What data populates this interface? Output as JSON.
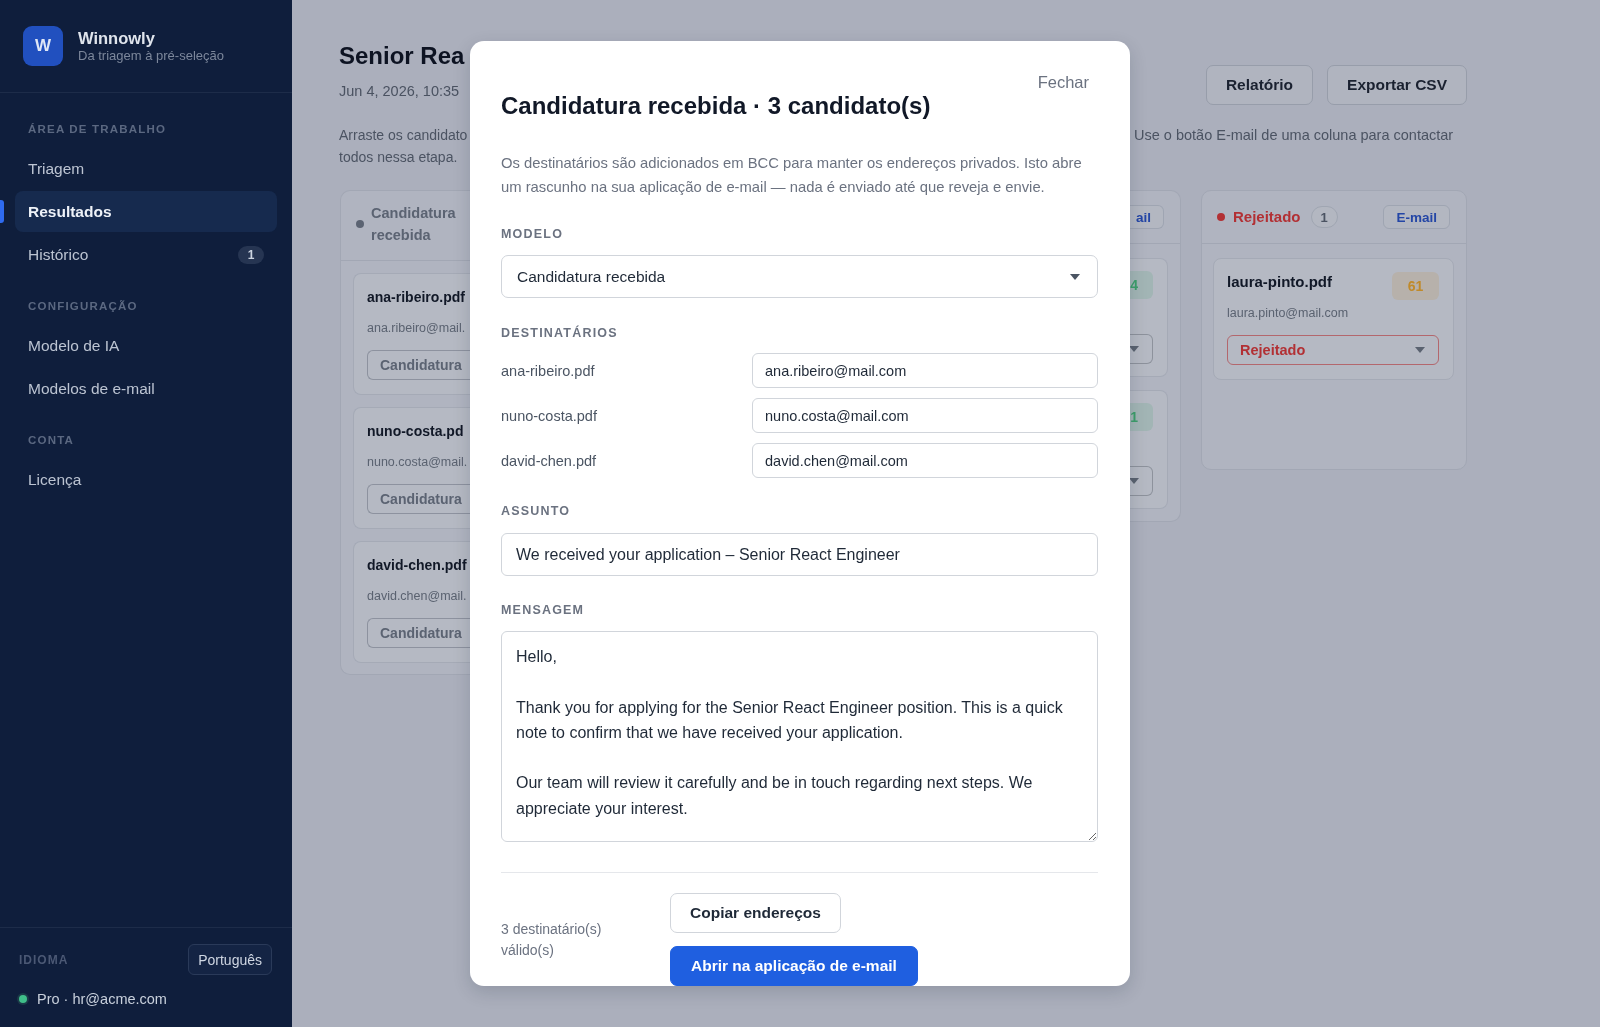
{
  "sidebar": {
    "logo": "W",
    "app_name": "Winnowly",
    "tagline": "Da triagem à pré-seleção",
    "sections": [
      {
        "heading": "ÁREA DE TRABALHO",
        "items": [
          {
            "label": "Triagem",
            "selected": false
          },
          {
            "label": "Resultados",
            "selected": true
          },
          {
            "label": "Histórico",
            "selected": false,
            "badge": "1"
          }
        ]
      },
      {
        "heading": "CONFIGURAÇÃO",
        "items": [
          {
            "label": "Modelo de IA",
            "selected": false
          },
          {
            "label": "Modelos de e-mail",
            "selected": false
          }
        ]
      },
      {
        "heading": "CONTA",
        "items": [
          {
            "label": "Licença",
            "selected": false
          }
        ]
      }
    ],
    "language": {
      "label": "IDIOMA",
      "button": "Português"
    },
    "account": {
      "color": "#3fbf8a",
      "text": "Pro · hr@acme.com"
    }
  },
  "page": {
    "title": "Senior Rea",
    "date": "Jun 4, 2026, 10:35",
    "description": {
      "line_1_left": "Arraste os candidato",
      "line_1_right": "Use o botão E-mail de uma coluna para contactar",
      "line_2": "todos nessa etapa."
    },
    "actions": [
      "Relatório",
      "Exportar CSV"
    ]
  },
  "board": {
    "columns": [
      {
        "kind": "left_part",
        "title": "Candidatura recebida",
        "color": "#5b6372",
        "cards": [
          {
            "file": "ana-ribeiro.pdf",
            "email": "ana.ribeiro@mail.",
            "status": "Candidatura"
          },
          {
            "file": "nuno-costa.pd",
            "email": "nuno.costa@mail.",
            "status": "Candidatura"
          },
          {
            "file": "david-chen.pdf",
            "email": "david.chen@mail.",
            "status": "Candidatura"
          }
        ]
      },
      {
        "kind": "right_part",
        "email_button": "ail",
        "cards": [
          {
            "score": "4",
            "color": "#3d9e6b"
          },
          {
            "score": "1",
            "color": "#3d9e6b"
          }
        ]
      },
      {
        "kind": "whole",
        "title": "Rejeitado",
        "color": "#b23034",
        "count": "1",
        "email_button": "E-mail",
        "cards": [
          {
            "file": "laura-pinto.pdf",
            "score": "61",
            "color": "#c08a2a",
            "email": "laura.pinto@mail.com",
            "status": "Rejeitado"
          }
        ]
      }
    ]
  },
  "modal": {
    "close": "Fechar",
    "title": "Candidatura recebida · 3 candidato(s)",
    "note": "Os destinatários são adicionados em BCC para manter os endereços privados. Isto abre um rascunho na sua aplicação de e-mail — nada é enviado até que reveja e envie.",
    "template": {
      "label": "MODELO",
      "value": "Candidatura recebida"
    },
    "recipients": {
      "label": "DESTINATÁRIOS",
      "rows": [
        {
          "file": "ana-ribeiro.pdf",
          "email": "ana.ribeiro@mail.com"
        },
        {
          "file": "nuno-costa.pdf",
          "email": "nuno.costa@mail.com"
        },
        {
          "file": "david-chen.pdf",
          "email": "david.chen@mail.com"
        }
      ]
    },
    "subject": {
      "label": "ASSUNTO",
      "value": "We received your application – Senior React Engineer"
    },
    "message": {
      "label": "MENSAGEM",
      "value": "Hello,\n\nThank you for applying for the Senior React Engineer position. This is a quick note to confirm that we have received your application.\n\nOur team will review it carefully and be in touch regarding next steps. We appreciate your interest."
    },
    "footer": {
      "status": "3 destinatário(s) válido(s)",
      "buttons": [
        {
          "label": "Copiar endereços",
          "kind": "secondary"
        },
        {
          "label": "Abrir na aplicação de e-mail",
          "kind": "primary"
        }
      ]
    }
  }
}
